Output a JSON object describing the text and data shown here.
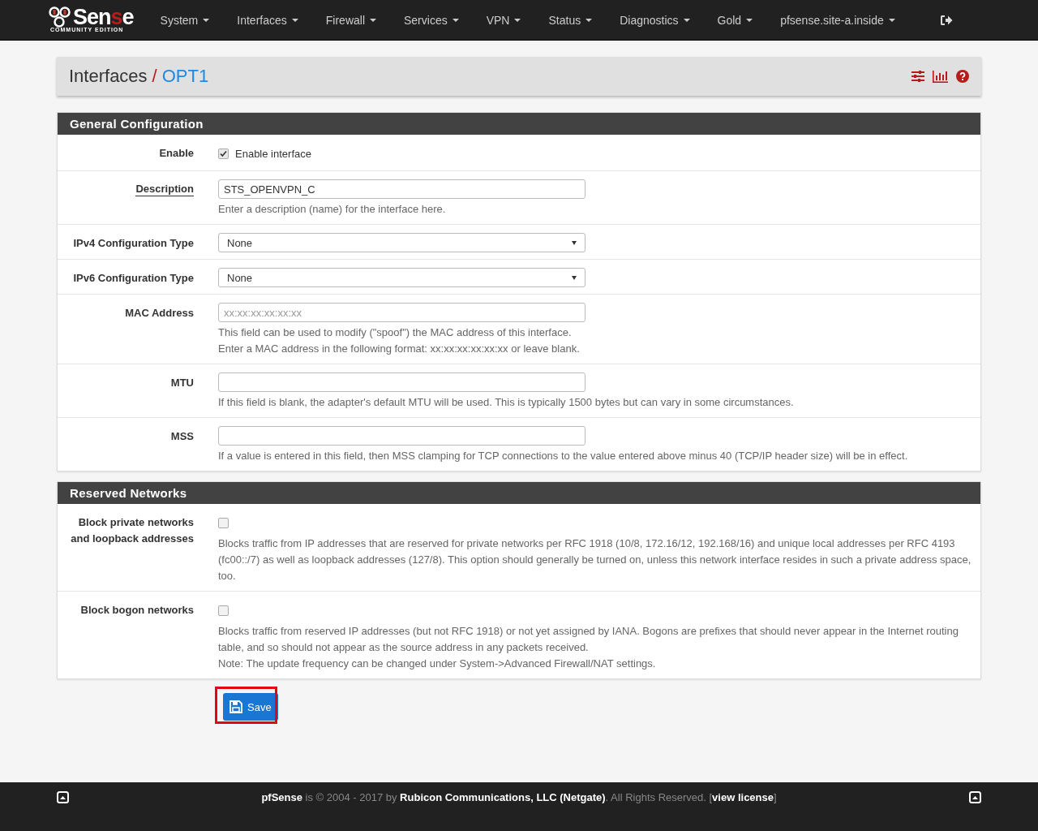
{
  "navbar": {
    "logo": {
      "prefix": "Sen",
      "accent": "s",
      "suffix": "e",
      "edition": "COMMUNITY EDITION"
    },
    "menus": [
      "System",
      "Interfaces",
      "Firewall",
      "Services",
      "VPN",
      "Status",
      "Diagnostics",
      "Gold",
      "pfsense.site-a.inside"
    ]
  },
  "breadcrumb": {
    "parent": "Interfaces",
    "separator": "/",
    "current": "OPT1"
  },
  "sections": [
    {
      "title": "General Configuration",
      "rows": [
        {
          "kind": "checkbox",
          "label": "Enable",
          "underlined": false,
          "checked": true,
          "option_label": "Enable interface"
        },
        {
          "kind": "text",
          "label": "Description",
          "underlined": true,
          "value": "STS_OPENVPN_C",
          "help": [
            "Enter a description (name) for the interface here."
          ]
        },
        {
          "kind": "select",
          "label": "IPv4 Configuration Type",
          "underlined": false,
          "value": "None"
        },
        {
          "kind": "select",
          "label": "IPv6 Configuration Type",
          "underlined": false,
          "value": "None"
        },
        {
          "kind": "text",
          "label": "MAC Address",
          "underlined": false,
          "placeholder": "xx:xx:xx:xx:xx:xx",
          "help": [
            "This field can be used to modify (\"spoof\") the MAC address of this interface.",
            "Enter a MAC address in the following format: xx:xx:xx:xx:xx:xx or leave blank."
          ]
        },
        {
          "kind": "text",
          "label": "MTU",
          "underlined": false,
          "help": [
            "If this field is blank, the adapter's default MTU will be used. This is typically 1500 bytes but can vary in some circumstances."
          ]
        },
        {
          "kind": "text",
          "label": "MSS",
          "underlined": false,
          "help": [
            "If a value is entered in this field, then MSS clamping for TCP connections to the value entered above minus 40 (TCP/IP header size) will be in effect."
          ]
        }
      ]
    },
    {
      "title": "Reserved Networks",
      "rows": [
        {
          "kind": "checkbox",
          "label": "Block private networks and loopback addresses",
          "underlined": false,
          "checked": false,
          "help": [
            "Blocks traffic from IP addresses that are reserved for private networks per RFC 1918 (10/8, 172.16/12, 192.168/16) and unique local addresses per RFC 4193 (fc00::/7) as well as loopback addresses (127/8). This option should generally be turned on, unless this network interface resides in such a private address space, too."
          ]
        },
        {
          "kind": "checkbox",
          "label": "Block bogon networks",
          "underlined": false,
          "checked": false,
          "help": [
            "Blocks traffic from reserved IP addresses (but not RFC 1918) or not yet assigned by IANA. Bogons are prefixes that should never appear in the Internet routing table, and so should not appear as the source address in any packets received.",
            "Note: The update frequency can be changed under System->Advanced Firewall/NAT settings."
          ]
        }
      ]
    }
  ],
  "save_button": {
    "label": "Save",
    "highlighted": true
  },
  "footer": {
    "text": "**pfSense** is © 2004 - 2017 by **Rubicon Communications, LLC (Netgate)**. All Rights Reserved. [**view license**]"
  }
}
